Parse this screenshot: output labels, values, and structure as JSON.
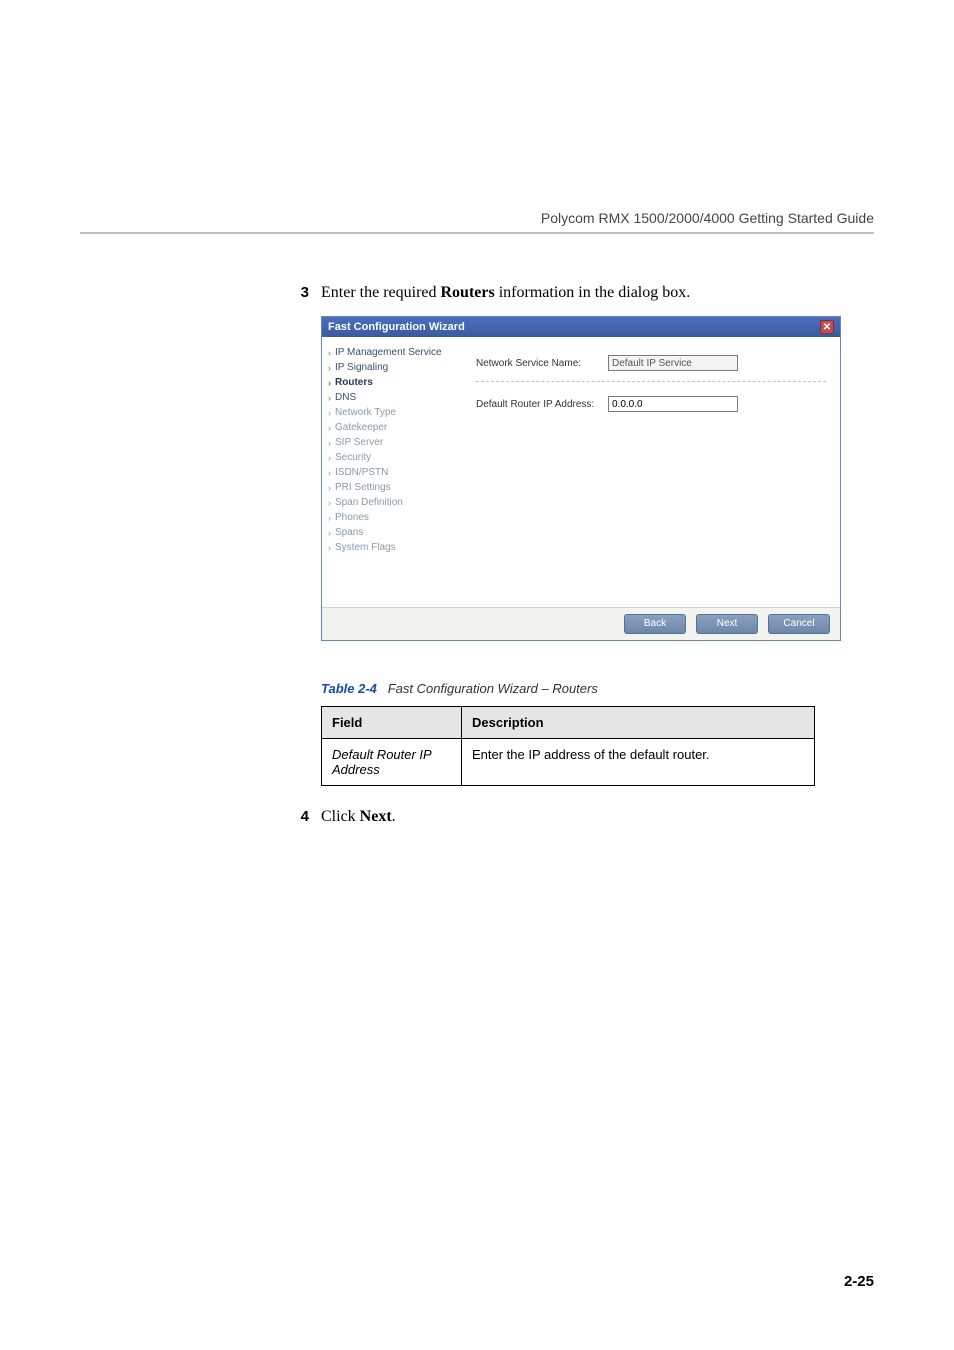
{
  "header": {
    "title": "Polycom RMX 1500/2000/4000 Getting Started Guide"
  },
  "steps": {
    "s3": {
      "num": "3",
      "prefix": "Enter the required ",
      "bold": "Routers",
      "suffix": " information in the dialog box."
    },
    "s4": {
      "num": "4",
      "prefix": "Click ",
      "bold": "Next",
      "suffix": "."
    }
  },
  "wizard": {
    "title": "Fast Configuration Wizard",
    "close": "✕",
    "nav": {
      "i0": "IP Management Service",
      "i1": "IP Signaling",
      "i2": "Routers",
      "i3": "DNS",
      "i4": "Network Type",
      "i5": "Gatekeeper",
      "i6": "SIP Server",
      "i7": "Security",
      "i8": "ISDN/PSTN",
      "i9": "PRI Settings",
      "i10": "Span Definition",
      "i11": "Phones",
      "i12": "Spans",
      "i13": "System Flags"
    },
    "form": {
      "service_label": "Network Service Name:",
      "service_value": "Default IP Service",
      "router_label": "Default Router IP Address:",
      "router_value": "0.0.0.0"
    },
    "buttons": {
      "back": "Back",
      "next": "Next",
      "cancel": "Cancel"
    }
  },
  "table": {
    "caption_label": "Table 2-4",
    "caption_text": "Fast Configuration Wizard – Routers",
    "head_field": "Field",
    "head_desc": "Description",
    "row1_field": "Default Router IP Address",
    "row1_desc": "Enter the IP address of the default router."
  },
  "pagenum": "2-25"
}
